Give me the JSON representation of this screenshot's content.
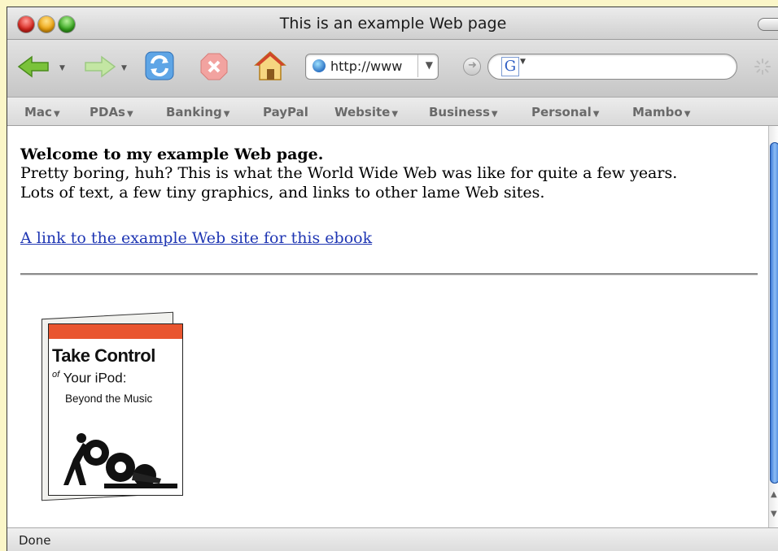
{
  "window": {
    "title": "This is an example Web page"
  },
  "toolbar": {
    "url_text": "http://www",
    "search_placeholder": ""
  },
  "bookmarks": [
    {
      "label": "Mac"
    },
    {
      "label": "PDAs"
    },
    {
      "label": "Banking"
    },
    {
      "label": "PayPal"
    },
    {
      "label": "Website"
    },
    {
      "label": "Business"
    },
    {
      "label": "Personal"
    },
    {
      "label": "Mambo"
    }
  ],
  "page": {
    "heading": "Welcome to my example Web page.",
    "line1": "Pretty boring, huh? This is what the World Wide Web was like for quite a few years.",
    "line2": "Lots of text, a few tiny graphics, and links to other lame Web sites.",
    "link": "A link to the example Web site for this ebook",
    "book": {
      "title": "Take Control",
      "of": "of",
      "subtitle": "Your iPod:",
      "tagline": "Beyond the Music"
    }
  },
  "status": {
    "text": "Done"
  },
  "colors": {
    "link": "#1f36b3",
    "thumb": "#3a7ad8",
    "page_bg": "#fbf6c8"
  }
}
